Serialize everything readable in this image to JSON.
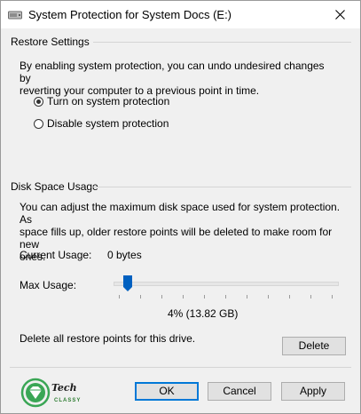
{
  "window": {
    "title": "System Protection for System Docs (E:)"
  },
  "restore_settings": {
    "header": "Restore Settings",
    "description_line1": "By enabling system protection, you can undo undesired changes by",
    "description_line2": "reverting your computer to a previous point in time.",
    "options": [
      {
        "label": "Turn on system protection",
        "checked": true
      },
      {
        "label": "Disable system protection",
        "checked": false
      }
    ]
  },
  "disk_space": {
    "header": "Disk Space Usage",
    "description_line1": "You can adjust the maximum disk space used for system protection. As",
    "description_line2": "space fills up, older restore points will be deleted to make room for new",
    "description_line3": "ones.",
    "current_usage_label": "Current Usage:",
    "current_usage_value": "0 bytes",
    "max_usage_label": "Max Usage:",
    "max_usage_percent": 4,
    "max_usage_readout": "4% (13.82 GB)",
    "delete_text": "Delete all restore points for this drive.",
    "delete_label": "Delete"
  },
  "footer": {
    "logo_text_line1": "Tech",
    "logo_text_line2": "CLASSY",
    "ok_label": "OK",
    "cancel_label": "Cancel",
    "apply_label": "Apply"
  },
  "colors": {
    "accent": "#0078d7",
    "slider_thumb": "#0060c0",
    "logo_green": "#3aa655"
  },
  "icons": [
    "drive-icon",
    "close-icon",
    "slider-thumb",
    "techclassy-logo"
  ]
}
